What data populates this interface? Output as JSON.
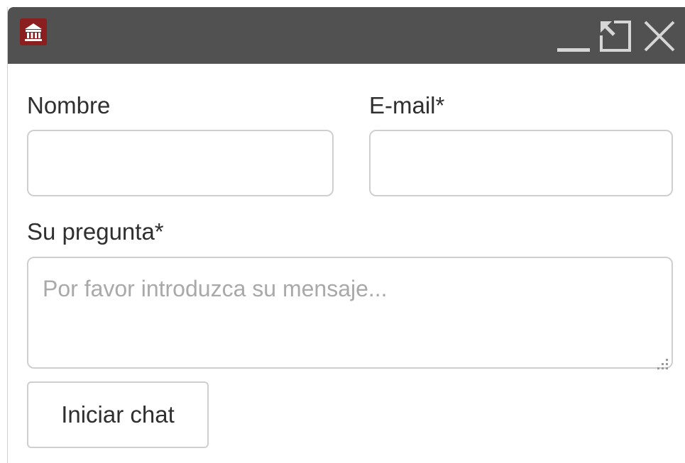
{
  "window": {
    "brand_icon": "bank-building-icon",
    "controls": {
      "minimize_icon": "minimize-icon",
      "maximize_icon": "expand-arrow-icon",
      "close_icon": "close-icon"
    }
  },
  "form": {
    "name_label": "Nombre",
    "name_value": "",
    "email_label": "E-mail*",
    "email_value": "",
    "question_label": "Su pregunta*",
    "question_value": "",
    "question_placeholder": "Por favor introduzca su mensaje...",
    "submit_label": "Iniciar chat"
  },
  "colors": {
    "titlebar": "#515151",
    "brand": "#8b1e1e",
    "field_border": "#cfcfcf"
  }
}
